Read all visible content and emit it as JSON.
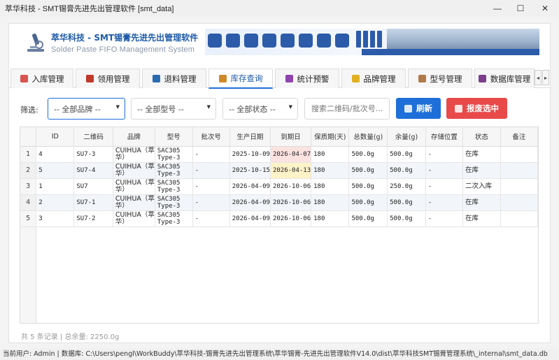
{
  "window": {
    "title": "萃华科技 - SMT锡膏先进先出管理软件 [smt_data]",
    "minimize": "—",
    "maximize": "☐",
    "close": "✕"
  },
  "header": {
    "title": "萃华科技 - SMT锡膏先进先出管理软件",
    "subtitle": "Solder Paste FIFO Management System"
  },
  "tabs": [
    {
      "label": "入库管理",
      "icon": "inbox-icon",
      "color": "#d9534f"
    },
    {
      "label": "领用管理",
      "icon": "hand-icon",
      "color": "#c0392b"
    },
    {
      "label": "退料管理",
      "icon": "return-icon",
      "color": "#2b6cb0"
    },
    {
      "label": "库存查询",
      "icon": "box-icon",
      "color": "#d08a2a",
      "active": true
    },
    {
      "label": "统计预警",
      "icon": "chart-icon",
      "color": "#8e44ad"
    },
    {
      "label": "品牌管理",
      "icon": "tag-icon",
      "color": "#e0b020"
    },
    {
      "label": "型号管理",
      "icon": "doc-icon",
      "color": "#b07a4a"
    },
    {
      "label": "数据库管理",
      "icon": "database-icon",
      "color": "#7b3f8c"
    }
  ],
  "tab_scroll": {
    "left": "◂",
    "right": "▸"
  },
  "filter": {
    "label": "筛选:",
    "brand": "-- 全部品牌 --",
    "model": "-- 全部型号 --",
    "status": "-- 全部状态 --",
    "caret": "▼",
    "search_placeholder": "搜索二维码/批次号...",
    "refresh": "刷新",
    "scrap": "报废选中"
  },
  "colors": {
    "accent": "#1e6fd9",
    "refresh_btn": "#1e6fd9",
    "scrap_btn": "#e84a4a",
    "expire_red": "#fde2e2",
    "expire_yellow": "#fdf2c8"
  },
  "table": {
    "columns": [
      "ID",
      "二维码",
      "品牌",
      "型号",
      "批次号",
      "生产日期",
      "到期日",
      "保质期(天)",
      "总数量(g)",
      "余量(g)",
      "存储位置",
      "状态",
      "备注"
    ],
    "rows": [
      {
        "n": "1",
        "id": "4",
        "qr": "SU7-3",
        "brand1": "CUIHUA（萃",
        "brand2": "华）",
        "model1": "SAC305",
        "model2": "Type-3",
        "batch": "-",
        "prod": "2025-10-09",
        "exp": "2026-04-07",
        "exp_flag": "red",
        "shelf": "180",
        "total": "500.0g",
        "remain": "500.0g",
        "loc": "-",
        "status": "在库",
        "note": ""
      },
      {
        "n": "2",
        "id": "5",
        "qr": "SU7-4",
        "brand1": "CUIHUA（萃",
        "brand2": "华）",
        "model1": "SAC305",
        "model2": "Type-3",
        "batch": "-",
        "prod": "2025-10-15",
        "exp": "2026-04-13",
        "exp_flag": "yellow",
        "shelf": "180",
        "total": "500.0g",
        "remain": "500.0g",
        "loc": "-",
        "status": "在库",
        "note": ""
      },
      {
        "n": "3",
        "id": "1",
        "qr": "SU7",
        "brand1": "CUIHUA（萃",
        "brand2": "华）",
        "model1": "SAC305",
        "model2": "Type-3",
        "batch": "-",
        "prod": "2026-04-09",
        "exp": "2026-10-06",
        "exp_flag": "",
        "shelf": "180",
        "total": "500.0g",
        "remain": "250.0g",
        "loc": "-",
        "status": "二次入库",
        "note": ""
      },
      {
        "n": "4",
        "id": "2",
        "qr": "SU7-1",
        "brand1": "CUIHUA（萃",
        "brand2": "华）",
        "model1": "SAC305",
        "model2": "Type-3",
        "batch": "-",
        "prod": "2026-04-09",
        "exp": "2026-10-06",
        "exp_flag": "",
        "shelf": "180",
        "total": "500.0g",
        "remain": "500.0g",
        "loc": "-",
        "status": "在库",
        "note": ""
      },
      {
        "n": "5",
        "id": "3",
        "qr": "SU7-2",
        "brand1": "CUIHUA（萃",
        "brand2": "华）",
        "model1": "SAC305",
        "model2": "Type-3",
        "batch": "-",
        "prod": "2026-04-09",
        "exp": "2026-10-06",
        "exp_flag": "",
        "shelf": "180",
        "total": "500.0g",
        "remain": "500.0g",
        "loc": "-",
        "status": "在库",
        "note": ""
      }
    ]
  },
  "summary": "共 5 条记录 | 总余量: 2250.0g",
  "statusbar": "当前用户: Admin | 数据库: C:\\Users\\pengl\\WorkBuddy\\萃华科技-锡膏先进先出管理系统\\萃华锡膏-先进先出管理软件V14.0\\dist\\萃华科技SMT锡膏管理系统\\_internal\\smt_data.db"
}
